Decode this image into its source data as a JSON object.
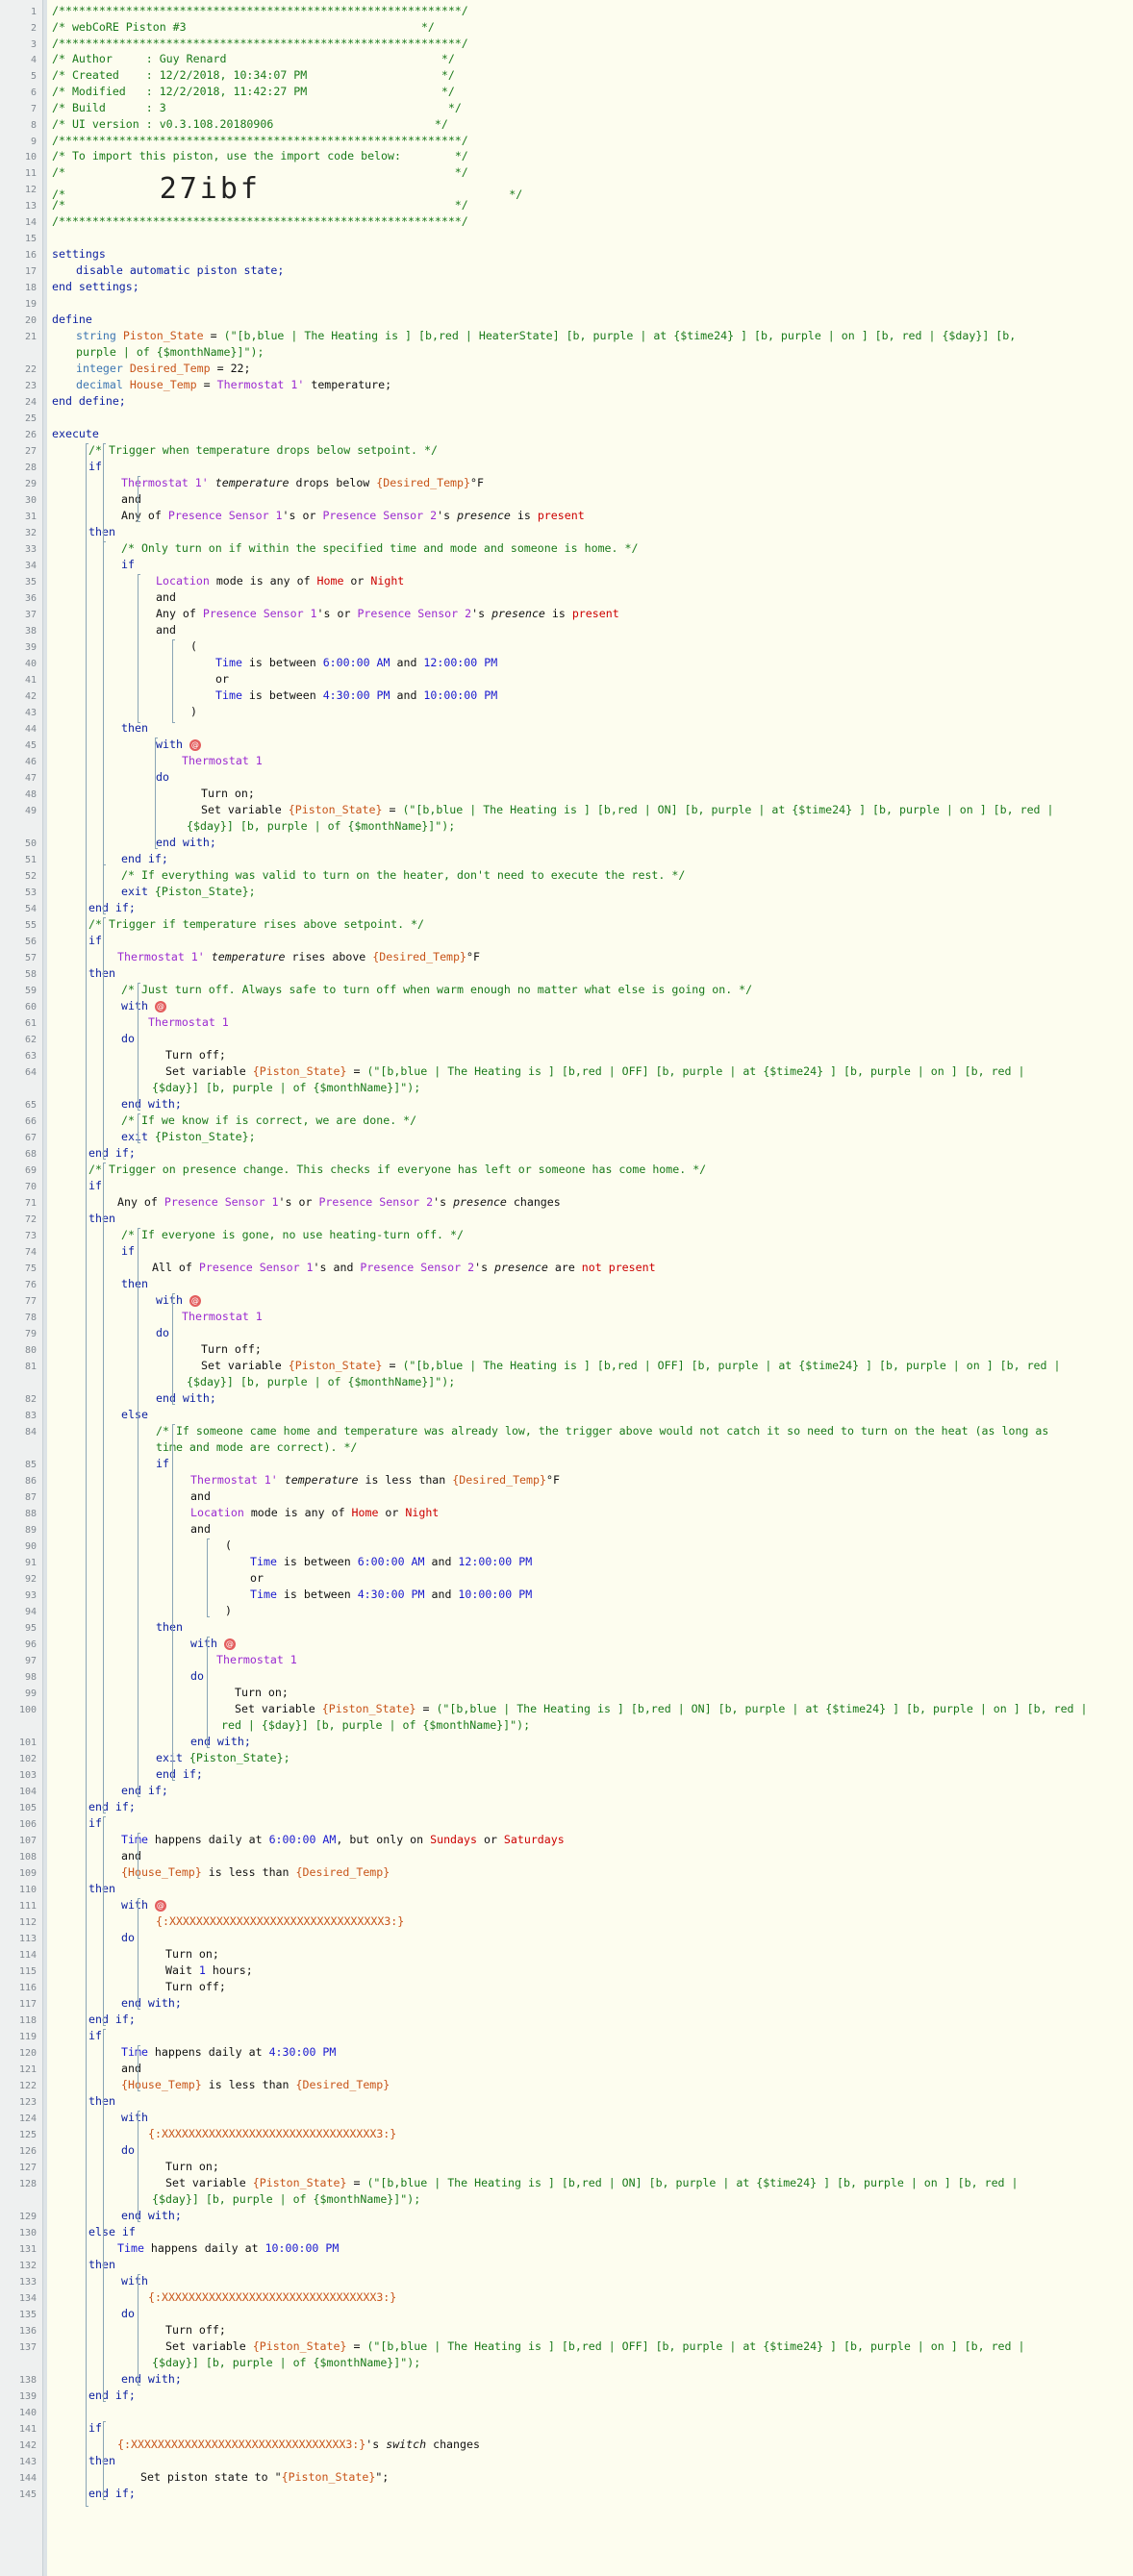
{
  "piston": {
    "title": "webCoRE Piston #3",
    "author": "Guy Renard",
    "created": "12/2/2018, 10:34:07 PM",
    "modified": "12/2/2018, 11:42:27 PM",
    "build": "3",
    "ui_version": "v0.3.108.20180906",
    "import_note": "To import this piston, use the import code below:",
    "import_code": "27ibf"
  },
  "devices": {
    "thermostat": "Thermostat 1",
    "thermostat_ref": "Thermostat 1'",
    "sensor1": "Presence Sensor 1",
    "sensor2": "Presence Sensor 2",
    "switch_placeholder": "{:XXXXXXXXXXXXXXXXXXXXXXXXXXXXXXXX3:}",
    "location": "Location"
  },
  "variables": {
    "piston_state": "Piston_State",
    "desired_temp": "Desired_Temp",
    "house_temp": "House_Temp",
    "desired_value": "22"
  },
  "strings": {
    "heater_state": "(\"[b,blue | The Heating is ] [b,red | HeaterState] [b, purple | at {$time24} ] [b, purple | on ] [b, red | {$day}] [b,",
    "heater_state_cont": "purple | of {$monthName}]\");",
    "on_1": "(\"[b,blue | The Heating is ] [b,red | ON] [b, purple | at {$time24} ] [b, purple | on ] [b, red |",
    "on_1_cont": "{$day}] [b, purple | of {$monthName}]\");",
    "off_1": "(\"[b,blue | The Heating is ] [b,red | OFF] [b, purple | at {$time24} ] [b, purple | on ] [b, red |",
    "off_1_cont": "{$day}] [b, purple | of {$monthName}]\");"
  },
  "comments": {
    "c27": "/* Trigger when temperature drops below setpoint. */",
    "c33": "/* Only turn on if within the specified time and mode and someone is home. */",
    "c52": "/* If everything was valid to turn on the heater, don't need to execute the rest. */",
    "c55": "/* Trigger if temperature rises above setpoint. */",
    "c59": "/* Just turn off. Always safe to turn off when warm enough no matter what else is going on. */",
    "c66": "/* If we know if is correct, we are done. */",
    "c69": "/* Trigger on presence change. This checks if everyone has left or someone has come home. */",
    "c73": "/* If everyone is gone, no use heating-turn off. */",
    "c84a": "/* If someone came home and temperature was already low, the trigger above would not catch it so need to turn on the heat (as long as",
    "c84b": "time and mode are correct). */"
  },
  "times": {
    "t600": "6:00:00 AM",
    "t1200": "12:00:00 PM",
    "t430": "4:30:00 PM",
    "t1000": "10:00:00 PM"
  },
  "values": {
    "home": "Home",
    "night": "Night",
    "present": "present",
    "not_present": "not present",
    "sundays": "Sundays",
    "saturdays": "Saturdays",
    "wait_hours": "1"
  }
}
